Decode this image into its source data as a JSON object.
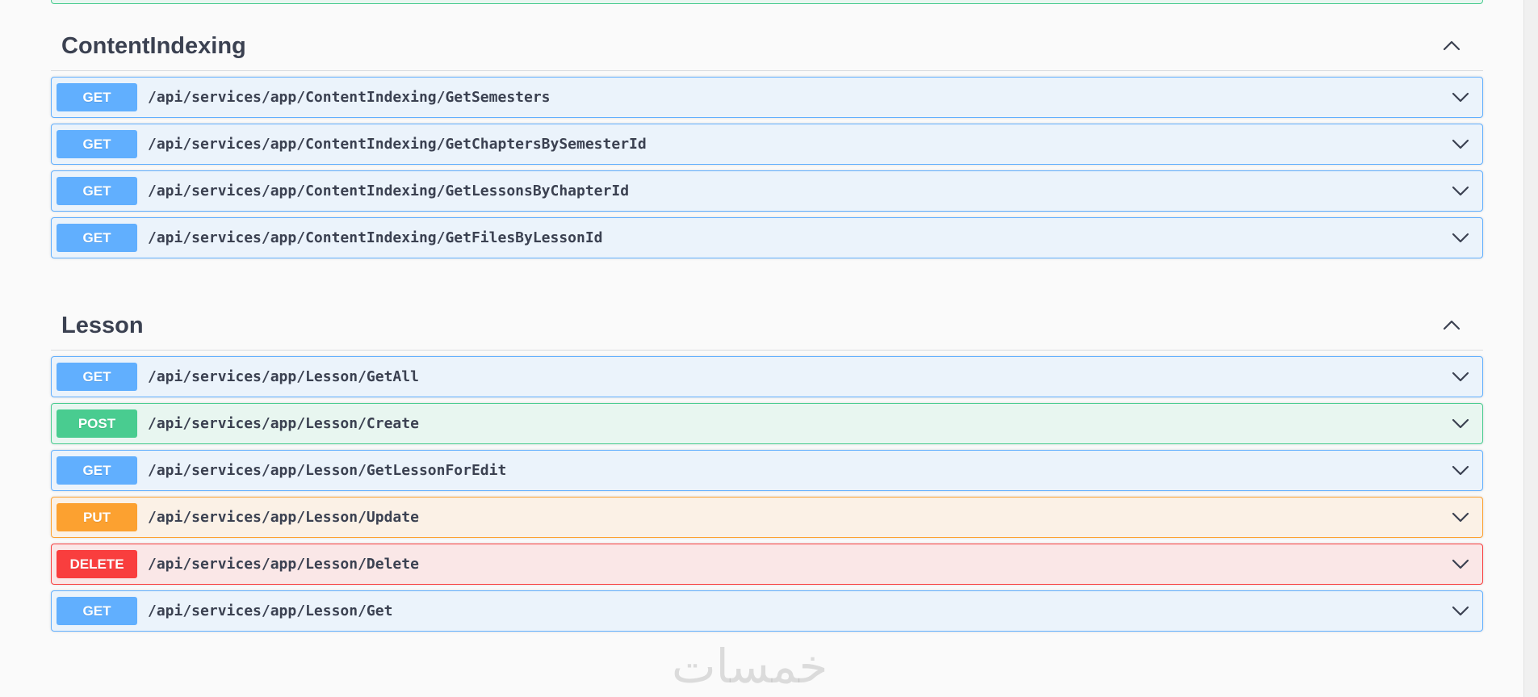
{
  "colors": {
    "get": "#61affe",
    "post": "#49cc90",
    "put": "#fca130",
    "delete": "#f93e3e",
    "text": "#3b4151",
    "background": "#fafafa"
  },
  "icons": {
    "tag_toggle": "chevron-up-icon",
    "operation_toggle": "chevron-down-icon"
  },
  "sections": [
    {
      "name": "ContentIndexing",
      "operations": [
        {
          "method": "GET",
          "path": "/api/services/app/ContentIndexing/GetSemesters"
        },
        {
          "method": "GET",
          "path": "/api/services/app/ContentIndexing/GetChaptersBySemesterId"
        },
        {
          "method": "GET",
          "path": "/api/services/app/ContentIndexing/GetLessonsByChapterId"
        },
        {
          "method": "GET",
          "path": "/api/services/app/ContentIndexing/GetFilesByLessonId"
        }
      ]
    },
    {
      "name": "Lesson",
      "operations": [
        {
          "method": "GET",
          "path": "/api/services/app/Lesson/GetAll"
        },
        {
          "method": "POST",
          "path": "/api/services/app/Lesson/Create"
        },
        {
          "method": "GET",
          "path": "/api/services/app/Lesson/GetLessonForEdit"
        },
        {
          "method": "PUT",
          "path": "/api/services/app/Lesson/Update"
        },
        {
          "method": "DELETE",
          "path": "/api/services/app/Lesson/Delete"
        },
        {
          "method": "GET",
          "path": "/api/services/app/Lesson/Get"
        }
      ]
    }
  ],
  "watermark": "خمسات"
}
